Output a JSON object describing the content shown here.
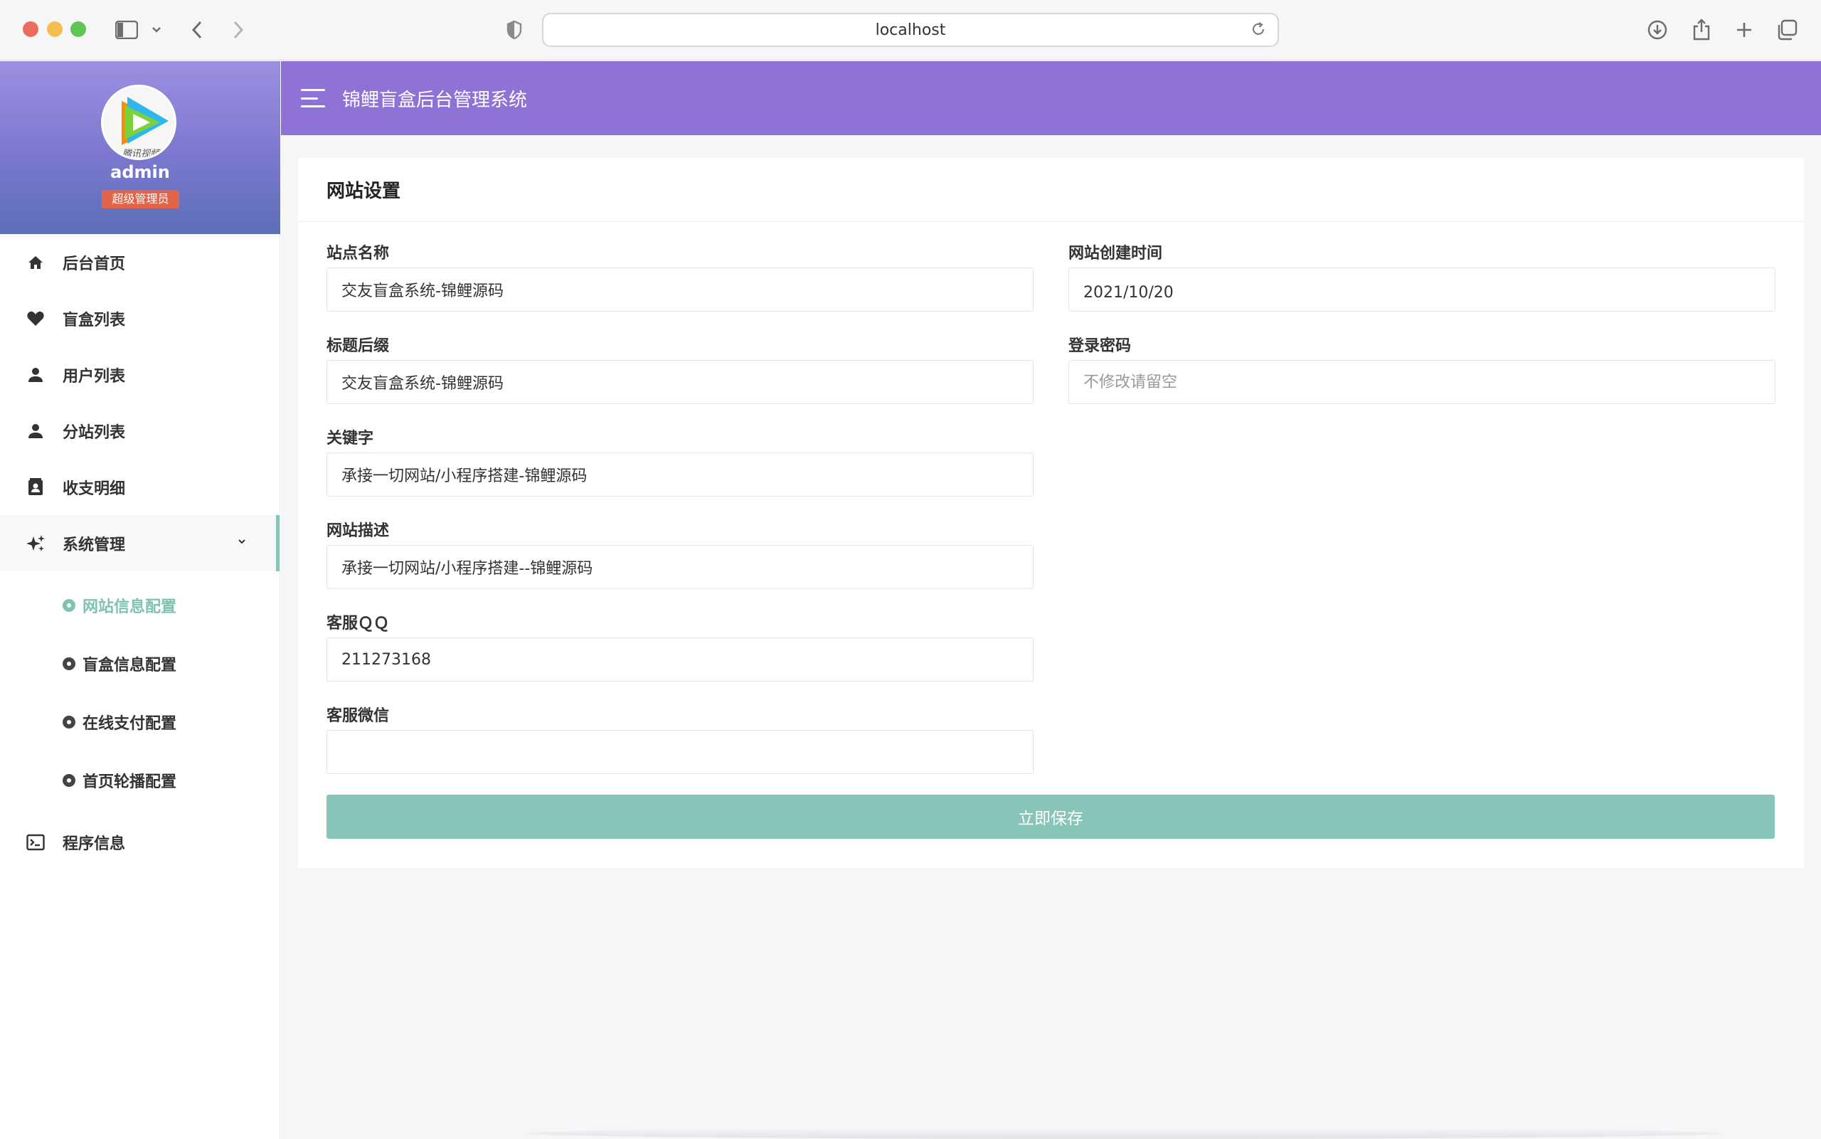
{
  "browser": {
    "url": "localhost"
  },
  "sidebar": {
    "username": "admin",
    "role": "超级管理员",
    "avatar_text": "腾讯视频",
    "items": [
      {
        "label": "后台首页",
        "icon": "home-icon"
      },
      {
        "label": "盲盒列表",
        "icon": "heart-icon"
      },
      {
        "label": "用户列表",
        "icon": "user-icon"
      },
      {
        "label": "分站列表",
        "icon": "user-icon"
      },
      {
        "label": "收支明细",
        "icon": "contact-card-icon"
      },
      {
        "label": "系统管理",
        "icon": "sparkle-icon"
      },
      {
        "label": "程序信息",
        "icon": "terminal-icon"
      }
    ],
    "subitems": [
      {
        "label": "网站信息配置",
        "active": true
      },
      {
        "label": "盲盒信息配置",
        "active": false
      },
      {
        "label": "在线支付配置",
        "active": false
      },
      {
        "label": "首页轮播配置",
        "active": false
      }
    ]
  },
  "header": {
    "title": "锦鲤盲盒后台管理系统"
  },
  "card": {
    "title": "网站设置",
    "fields": {
      "site_name": {
        "label": "站点名称",
        "value": "交友盲盒系统-锦鲤源码"
      },
      "title_suffix": {
        "label": "标题后缀",
        "value": "交友盲盒系统-锦鲤源码"
      },
      "keywords": {
        "label": "关键字",
        "value": "承接一切网站/小程序搭建-锦鲤源码"
      },
      "description": {
        "label": "网站描述",
        "value": "承接一切网站/小程序搭建--锦鲤源码"
      },
      "qq": {
        "label": "客服ＱＱ",
        "value": "211273168"
      },
      "wechat": {
        "label": "客服微信",
        "value": ""
      },
      "created": {
        "label": "网站创建时间",
        "value": "2021/10/20"
      },
      "password": {
        "label": "登录密码",
        "placeholder": "不修改请留空"
      }
    },
    "save_label": "立即保存"
  },
  "colors": {
    "header": "#8f72d6",
    "accent": "#86c5b7",
    "badge": "#e0654a"
  }
}
